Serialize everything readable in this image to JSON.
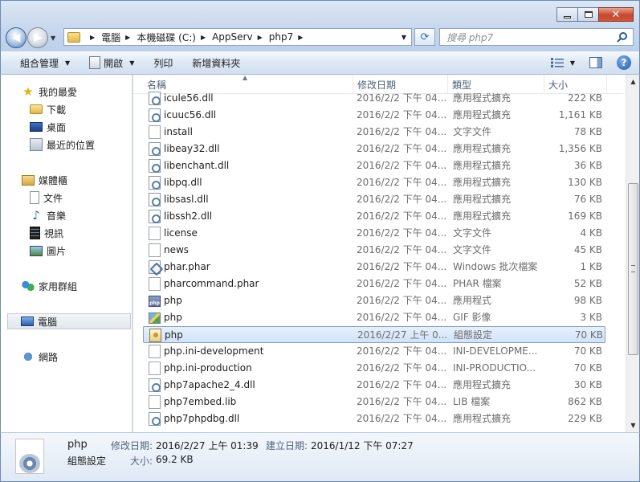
{
  "address": {
    "crumbs": [
      "電腦",
      "本機磁碟 (C:)",
      "AppServ",
      "php7"
    ],
    "search_placeholder": "搜尋 php7"
  },
  "toolbar": {
    "organize": "組合管理",
    "open": "開啟",
    "print": "列印",
    "new_folder": "新增資料夾"
  },
  "nav": {
    "favorites": "我的最愛",
    "downloads": "下載",
    "desktop": "桌面",
    "recent": "最近的位置",
    "libraries": "媒體櫃",
    "documents": "文件",
    "music": "音樂",
    "videos": "視訊",
    "pictures": "圖片",
    "homegroup": "家用群組",
    "computer": "電腦",
    "network": "網路"
  },
  "columns": {
    "name": "名稱",
    "date": "修改日期",
    "type": "類型",
    "size": "大小"
  },
  "files": [
    {
      "name": "icule56.dll",
      "date": "2016/2/2 下午 04...",
      "type": "應用程式擴充",
      "size": "222 KB",
      "icon": "dll"
    },
    {
      "name": "icuuc56.dll",
      "date": "2016/2/2 下午 04...",
      "type": "應用程式擴充",
      "size": "1,161 KB",
      "icon": "dll"
    },
    {
      "name": "install",
      "date": "2016/2/2 下午 04...",
      "type": "文字文件",
      "size": "78 KB",
      "icon": "txt"
    },
    {
      "name": "libeay32.dll",
      "date": "2016/2/2 下午 04...",
      "type": "應用程式擴充",
      "size": "1,356 KB",
      "icon": "dll"
    },
    {
      "name": "libenchant.dll",
      "date": "2016/2/2 下午 04...",
      "type": "應用程式擴充",
      "size": "36 KB",
      "icon": "dll"
    },
    {
      "name": "libpq.dll",
      "date": "2016/2/2 下午 04...",
      "type": "應用程式擴充",
      "size": "130 KB",
      "icon": "dll"
    },
    {
      "name": "libsasl.dll",
      "date": "2016/2/2 下午 04...",
      "type": "應用程式擴充",
      "size": "76 KB",
      "icon": "dll"
    },
    {
      "name": "libssh2.dll",
      "date": "2016/2/2 下午 04...",
      "type": "應用程式擴充",
      "size": "169 KB",
      "icon": "dll"
    },
    {
      "name": "license",
      "date": "2016/2/2 下午 04...",
      "type": "文字文件",
      "size": "4 KB",
      "icon": "txt"
    },
    {
      "name": "news",
      "date": "2016/2/2 下午 04...",
      "type": "文字文件",
      "size": "45 KB",
      "icon": "txt"
    },
    {
      "name": "phar.phar",
      "date": "2016/2/2 下午 04...",
      "type": "Windows 批次檔案",
      "size": "1 KB",
      "icon": "phar"
    },
    {
      "name": "pharcommand.phar",
      "date": "2016/2/2 下午 04...",
      "type": "PHAR 檔案",
      "size": "52 KB",
      "icon": "txt"
    },
    {
      "name": "php",
      "date": "2016/2/2 下午 04...",
      "type": "應用程式",
      "size": "98 KB",
      "icon": "exe"
    },
    {
      "name": "php",
      "date": "2016/2/2 下午 04...",
      "type": "GIF 影像",
      "size": "3 KB",
      "icon": "gif"
    },
    {
      "name": "php",
      "date": "2016/2/27 上午 0...",
      "type": "組態設定",
      "size": "70 KB",
      "icon": "ini",
      "selected": true
    },
    {
      "name": "php.ini-development",
      "date": "2016/2/2 下午 04...",
      "type": "INI-DEVELOPME...",
      "size": "70 KB",
      "icon": "txt"
    },
    {
      "name": "php.ini-production",
      "date": "2016/2/2 下午 04...",
      "type": "INI-PRODUCTIO...",
      "size": "70 KB",
      "icon": "txt"
    },
    {
      "name": "php7apache2_4.dll",
      "date": "2016/2/2 下午 04...",
      "type": "應用程式擴充",
      "size": "30 KB",
      "icon": "dll"
    },
    {
      "name": "php7embed.lib",
      "date": "2016/2/2 下午 04...",
      "type": "LIB 檔案",
      "size": "862 KB",
      "icon": "txt"
    },
    {
      "name": "php7phpdbg.dll",
      "date": "2016/2/2 下午 04...",
      "type": "應用程式擴充",
      "size": "229 KB",
      "icon": "dll"
    }
  ],
  "details": {
    "name": "php",
    "type": "組態設定",
    "modified_label": "修改日期:",
    "modified": "2016/2/27 上午 01:39",
    "created_label": "建立日期:",
    "created": "2016/1/12 下午 07:27",
    "size_label": "大小:",
    "size": "69.2 KB"
  }
}
